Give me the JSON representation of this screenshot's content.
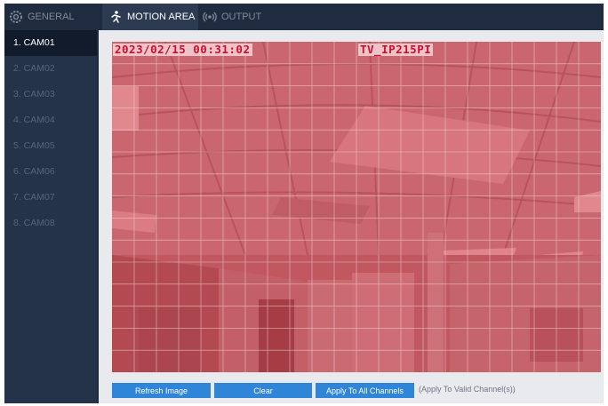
{
  "tabs": {
    "general": "GENERAL",
    "motion_area": "MOTION AREA",
    "output": "OUTPUT"
  },
  "cameras": [
    {
      "label": "1. CAM01",
      "active": true
    },
    {
      "label": "2. CAM02",
      "active": false
    },
    {
      "label": "3. CAM03",
      "active": false
    },
    {
      "label": "4. CAM04",
      "active": false
    },
    {
      "label": "5. CAM05",
      "active": false
    },
    {
      "label": "6. CAM06",
      "active": false
    },
    {
      "label": "7. CAM07",
      "active": false
    },
    {
      "label": "8. CAM08",
      "active": false
    }
  ],
  "preview": {
    "timestamp": "2023/02/15 00:31:02",
    "camera_name": "TV_IP215PI",
    "motion_overlay_color": "#d82f3a",
    "motion_grid": {
      "columns": 22,
      "rows": 15,
      "all_selected": true
    }
  },
  "buttons": {
    "refresh": "Refresh Image",
    "clear": "Clear",
    "apply_all": "Apply To All Channels"
  },
  "apply_note": "(Apply To Valid Channel(s))",
  "colors": {
    "accent": "#2f86d9",
    "sidebar_bg": "#24334a",
    "active_item_bg": "#111b2b",
    "active_tab_bg": "#2c3a52"
  },
  "icons": {
    "general": "gear-icon",
    "motion_area": "motion-running-icon",
    "output": "broadcast-icon"
  }
}
